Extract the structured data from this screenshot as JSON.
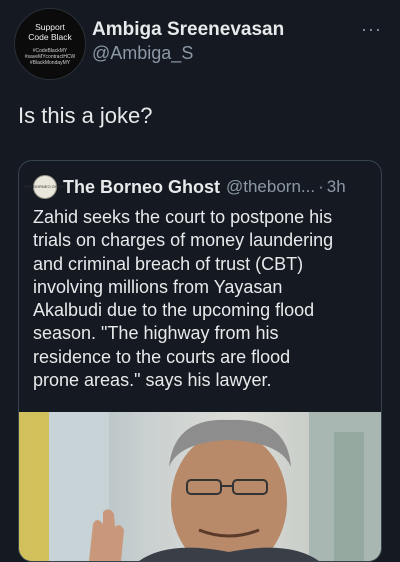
{
  "author": {
    "name": "Ambiga Sreenevasan",
    "handle": "@Ambiga_S",
    "avatar": {
      "line1": "Support",
      "line2": "Code Black",
      "tag1": "#CodeBlackMY",
      "tag2": "#saveMYcontractHCW",
      "tag3": "#BlackMondayMY"
    }
  },
  "more_icon": "more-horizontal-icon",
  "tweet_text": "Is this a joke?",
  "quoted": {
    "name": "The Borneo Ghost",
    "handle": "@theborn...",
    "separator": "·",
    "time": "3h",
    "avatar_text": "THE BORNEO GHOST",
    "lines": [
      "Zahid seeks the court to postpone his",
      "trials on charges of money laundering",
      "and criminal breach of trust (CBT)",
      "involving millions from Yayasan",
      "Akalbudi due to the upcoming flood",
      "season. \"The highway from his",
      "residence to the courts are flood",
      "prone areas.\" says his lawyer."
    ]
  },
  "colors": {
    "background": "#151a22",
    "text": "#e7e9ea",
    "secondary": "#8b98a5",
    "border": "#38444d"
  }
}
